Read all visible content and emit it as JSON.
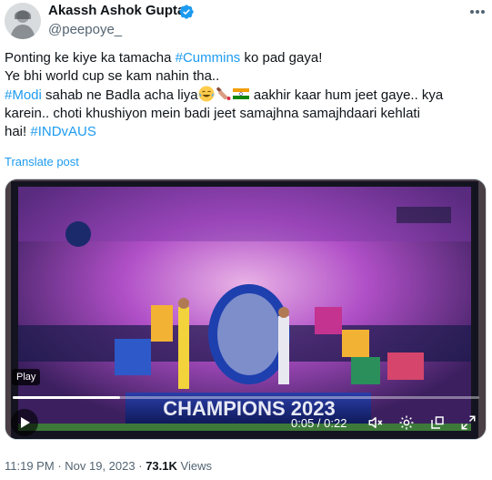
{
  "author": {
    "name": "Akassh Ashok Gupta",
    "handle": "@peepoye_",
    "verified": true
  },
  "tweet": {
    "line1_pre": "Ponting ke kiye ka tamacha ",
    "line1_tag": "#Cummins",
    "line1_post": " ko pad gaya!",
    "line2": "Ye bhi world cup se kam nahin tha..",
    "line3_tag": "#Modi",
    "line3_mid": " sahab ne Badla acha liya",
    "line3_post": " aakhir kaar hum jeet gaye.. kya",
    "line4": "karein.. choti khushiyon mein badi jeet samajhna samajhdaari kehlati",
    "line5_pre": "hai! ",
    "line5_tag": "#INDvAUS",
    "emojis": [
      "face-with-tears-of-joy-icon",
      "cricket-bat-icon",
      "india-flag-icon"
    ]
  },
  "translate_label": "Translate post",
  "video": {
    "play_label": "Play",
    "banner_text": "CHAMPIONS 2023",
    "elapsed": "0:05",
    "duration": "0:22",
    "time_text": "0:05 / 0:22",
    "progress": 0.23,
    "controls": [
      "play-icon",
      "volume-muted-icon",
      "settings-gear-icon",
      "pop-out-icon",
      "fullscreen-icon"
    ]
  },
  "meta": {
    "time": "11:19 PM",
    "date": "Nov 19, 2023",
    "views_count": "73.1K",
    "views_label": "Views"
  },
  "colors": {
    "link": "#1d9bf0",
    "text": "#0f1419",
    "secondary": "#536471",
    "verified": "#1d9bf0"
  }
}
